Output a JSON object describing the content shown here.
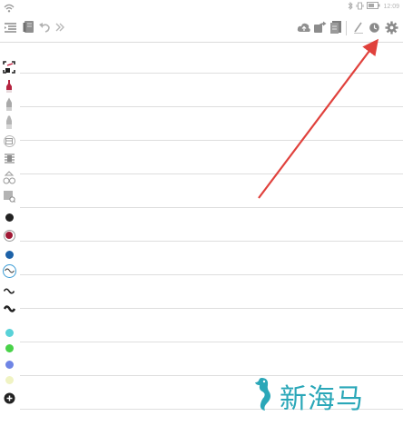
{
  "status": {
    "time": "12:09"
  },
  "toolbar": {
    "left_icons": [
      "menu-list-icon",
      "notebook-icon",
      "undo-icon",
      "chevrons-right-icon"
    ],
    "right_icons": [
      "cloud-upload-icon",
      "share-icon",
      "document-icon",
      "pen-icon",
      "history-icon",
      "gear-icon"
    ]
  },
  "left_panel": {
    "tools": [
      "select-crop-icon",
      "highlighter-pen-icon",
      "pencil-icon",
      "marker-icon",
      "eraser-icon",
      "text-align-icon",
      "shapes-icon",
      "image-edit-icon"
    ],
    "colors": [
      "#222222",
      "#a01835",
      "#1d62a8"
    ],
    "strokes": [
      "wave-thin-icon",
      "wave-medium-icon",
      "wave-bold-icon"
    ],
    "palette": [
      "#59d2d8",
      "#49d249",
      "#6f85e5",
      "#f0f3c3"
    ],
    "add_icon": "add-color-icon"
  },
  "watermark": {
    "text": "新海马"
  },
  "annotation": {
    "color": "#e0413c",
    "points_to": "gear-icon"
  }
}
